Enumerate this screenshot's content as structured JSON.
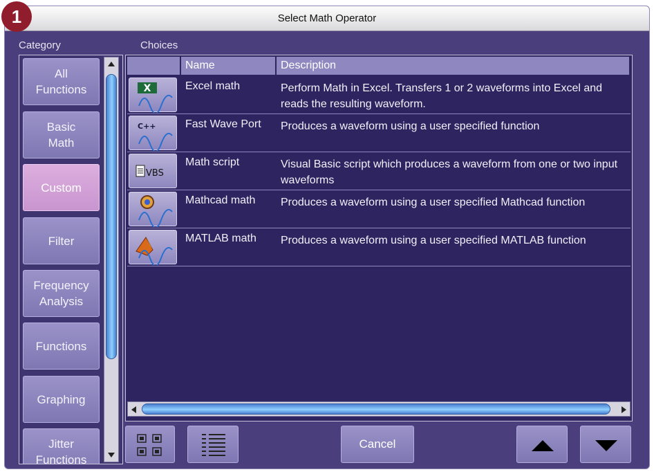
{
  "step_badge": "1",
  "window": {
    "title": "Select Math Operator"
  },
  "labels": {
    "category": "Category",
    "choices": "Choices"
  },
  "categories": [
    {
      "label": "All\nFunctions",
      "selected": false
    },
    {
      "label": "Basic\nMath",
      "selected": false
    },
    {
      "label": "Custom",
      "selected": true
    },
    {
      "label": "Filter",
      "selected": false
    },
    {
      "label": "Frequency\nAnalysis",
      "selected": false
    },
    {
      "label": "Functions",
      "selected": false
    },
    {
      "label": "Graphing",
      "selected": false
    },
    {
      "label": "Jitter\nFunctions",
      "selected": false
    }
  ],
  "table": {
    "headers": {
      "name": "Name",
      "description": "Description"
    },
    "rows": [
      {
        "icon": "excel-icon",
        "name": "Excel math",
        "description": "Perform Math in Excel. Transfers 1 or 2 waveforms into Excel and reads the resulting waveform."
      },
      {
        "icon": "cpp-icon",
        "name": "Fast Wave Port",
        "description": "Produces a waveform using a user specified function"
      },
      {
        "icon": "vbs-script-icon",
        "icon_text": "VBS",
        "name": "Math script",
        "description": "Visual Basic script which produces a waveform from one or two input waveforms"
      },
      {
        "icon": "mathcad-icon",
        "name": "Mathcad math",
        "description": "Produces a waveform using a user specified Mathcad function"
      },
      {
        "icon": "matlab-icon",
        "name": "MATLAB math",
        "description": "Produces a waveform using a user specified MATLAB function"
      }
    ]
  },
  "buttons": {
    "cancel": "Cancel",
    "icon_view": "grid-view-icon",
    "list_view": "list-view-icon",
    "move_up": "up-arrow-icon",
    "move_down": "down-arrow-icon"
  },
  "colors": {
    "panel_bg": "#4a3e7c",
    "list_bg": "#2e2460",
    "button": "#8f87c0",
    "selected_category": "#d4a4d8",
    "badge": "#8f1d2c",
    "scroll_thumb": "#6fb8f0"
  }
}
